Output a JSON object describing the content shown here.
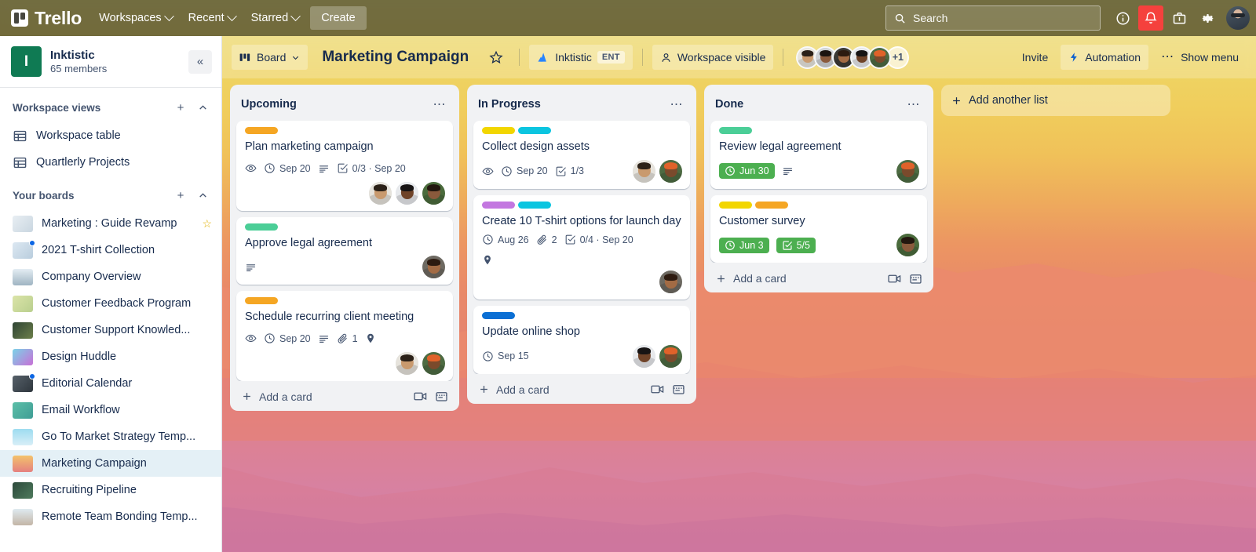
{
  "topnav": {
    "brand": "Trello",
    "menus": [
      {
        "label": "Workspaces",
        "name": "workspaces"
      },
      {
        "label": "Recent",
        "name": "recent"
      },
      {
        "label": "Starred",
        "name": "starred"
      }
    ],
    "create_label": "Create",
    "search_placeholder": "Search",
    "icons": [
      "info-icon",
      "notification-bell-icon",
      "briefcase-icon",
      "gear-icon",
      "user-avatar"
    ],
    "accent_alert": "#f5413d"
  },
  "sidebar": {
    "workspace": {
      "initial": "I",
      "name": "Inktistic",
      "members": "65 members",
      "logo_color": "#0f7a53",
      "collapse_label": "«"
    },
    "sections": [
      {
        "title": "Workspace views",
        "add_label": "+",
        "collapse_label": "⌃",
        "items": [
          {
            "label": "Workspace table",
            "icon": "table-icon"
          },
          {
            "label": "Quartlerly Projects",
            "icon": "table-icon"
          }
        ]
      },
      {
        "title": "Your boards",
        "add_label": "+",
        "collapse_label": "⌃",
        "items": [
          {
            "label": "Marketing : Guide Revamp",
            "starred": true,
            "badge": false,
            "thumb": "linear-gradient(135deg,#e8eef3,#c9d6e0)"
          },
          {
            "label": "2021 T-shirt Collection",
            "starred": false,
            "badge": true,
            "thumb": "linear-gradient(135deg,#dce8f2,#b9cddd)"
          },
          {
            "label": "Company Overview",
            "starred": false,
            "badge": false,
            "thumb": "linear-gradient(180deg,#e4edf3,#9fb4c2)"
          },
          {
            "label": "Customer Feedback Program",
            "starred": false,
            "badge": false,
            "thumb": "linear-gradient(135deg,#dbe4a8,#b9cf8e)"
          },
          {
            "label": "Customer Support Knowled...",
            "starred": false,
            "badge": false,
            "thumb": "linear-gradient(135deg,#2f4434,#6c7f4a)"
          },
          {
            "label": "Design Huddle",
            "starred": false,
            "badge": false,
            "thumb": "linear-gradient(135deg,#7ad3e8,#c86fd6)"
          },
          {
            "label": "Editorial Calendar",
            "starred": false,
            "badge": true,
            "thumb": "linear-gradient(135deg,#566069,#2e363d)"
          },
          {
            "label": "Email Workflow",
            "starred": false,
            "badge": false,
            "thumb": "linear-gradient(135deg,#5cbfa8,#3f9d95)"
          },
          {
            "label": "Go To Market Strategy Temp...",
            "starred": false,
            "badge": false,
            "thumb": "linear-gradient(180deg,#9ddcf0,#d8eef7)"
          },
          {
            "label": "Marketing Campaign",
            "starred": false,
            "badge": false,
            "active": true,
            "thumb": "linear-gradient(180deg,#f3c26b,#e5807f)"
          },
          {
            "label": "Recruiting Pipeline",
            "starred": false,
            "badge": false,
            "thumb": "linear-gradient(135deg,#2d4a3c,#4e7a5c)"
          },
          {
            "label": "Remote Team Bonding Temp...",
            "starred": false,
            "badge": false,
            "thumb": "linear-gradient(180deg,#dfeaf0,#c3b5a6)"
          }
        ]
      }
    ]
  },
  "board_header": {
    "view_label": "Board",
    "title": "Marketing Campaign",
    "star_icon": "star-outline-icon",
    "workspace_name": "Inktistic",
    "workspace_plan": "ENT",
    "visibility_label": "Workspace visible",
    "member_overflow": "+1",
    "invite_label": "Invite",
    "automation_label": "Automation",
    "show_menu_label": "Show menu",
    "members": [
      {
        "name": "member-1",
        "skin": "#c99a6e",
        "hair": "#2b2118",
        "shirt": "#e9e6de"
      },
      {
        "name": "member-2",
        "skin": "#8a5a3c",
        "hair": "#1c1410",
        "shirt": "#cfd3d6"
      },
      {
        "name": "member-3",
        "skin": "#a36b44",
        "hair": "#2d1b10",
        "shirt": "#3c3a35"
      },
      {
        "name": "member-4",
        "skin": "#6f4328",
        "hair": "#171414",
        "shirt": "#e7e9ec"
      },
      {
        "name": "member-5",
        "skin": "#7a4a2c",
        "hair": "#e0622a",
        "shirt": "#4d6b42"
      }
    ]
  },
  "board": {
    "add_list_label": "Add another list",
    "add_card_label": "Add a card",
    "lists": [
      {
        "title": "Upcoming",
        "cards": [
          {
            "title": "Plan marketing campaign",
            "labels": [
              "#f5a623"
            ],
            "badges": [
              {
                "type": "watch",
                "text": ""
              },
              {
                "type": "due",
                "text": "Sep 20"
              },
              {
                "type": "description",
                "text": ""
              },
              {
                "type": "checklist",
                "text": "0/3 · Sep 20"
              }
            ],
            "members": [
              {
                "skin": "#c99a6e",
                "hair": "#2b2118",
                "shirt": "#e6e3dc"
              },
              {
                "skin": "#6f4328",
                "hair": "#171414",
                "shirt": "#e7e9ec"
              },
              {
                "skin": "#8a5a3c",
                "hair": "#23170f",
                "shirt": "#4a6b3c"
              }
            ],
            "members_inline": false
          },
          {
            "title": "Approve legal agreement",
            "labels": [
              "#4bce97"
            ],
            "badges": [
              {
                "type": "description",
                "text": ""
              }
            ],
            "members": [
              {
                "skin": "#a36b44",
                "hair": "#2d1b10",
                "shirt": "#6e6a62"
              }
            ],
            "members_inline": true
          },
          {
            "title": "Schedule recurring client meeting",
            "labels": [
              "#f5a623"
            ],
            "badges": [
              {
                "type": "watch",
                "text": ""
              },
              {
                "type": "due",
                "text": "Sep 20"
              },
              {
                "type": "description",
                "text": ""
              },
              {
                "type": "attachment",
                "text": "1"
              },
              {
                "type": "location",
                "text": ""
              }
            ],
            "members": [
              {
                "skin": "#c99a6e",
                "hair": "#2b2118",
                "shirt": "#e6e3dc"
              },
              {
                "skin": "#7a4a2c",
                "hair": "#e0622a",
                "shirt": "#4d6b42"
              }
            ],
            "members_inline": false
          }
        ]
      },
      {
        "title": "In Progress",
        "cards": [
          {
            "title": "Collect design assets",
            "labels": [
              "#f2d600",
              "#0bc5e0"
            ],
            "badges": [
              {
                "type": "watch",
                "text": ""
              },
              {
                "type": "due",
                "text": "Sep 20"
              },
              {
                "type": "checklist",
                "text": "1/3"
              }
            ],
            "members": [
              {
                "skin": "#c99a6e",
                "hair": "#2b2118",
                "shirt": "#e6e3dc"
              },
              {
                "skin": "#7a4a2c",
                "hair": "#e0622a",
                "shirt": "#4d6b42"
              }
            ],
            "members_inline": true
          },
          {
            "title": "Create 10 T-shirt options for launch day",
            "labels": [
              "#c377e0",
              "#0bc5e0"
            ],
            "badges": [
              {
                "type": "due",
                "text": "Aug 26"
              },
              {
                "type": "attachment",
                "text": "2"
              },
              {
                "type": "checklist",
                "text": "0/4 · Sep 20"
              },
              {
                "type": "location-row",
                "text": ""
              }
            ],
            "members": [
              {
                "skin": "#a36b44",
                "hair": "#2d1b10",
                "shirt": "#6e6a62"
              }
            ],
            "members_inline": false
          },
          {
            "title": "Update online shop",
            "labels": [
              "#0b6fd4"
            ],
            "badges": [
              {
                "type": "due",
                "text": "Sep 15"
              }
            ],
            "members": [
              {
                "skin": "#6f4328",
                "hair": "#171414",
                "shirt": "#e7e9ec"
              },
              {
                "skin": "#7a4a2c",
                "hair": "#e0622a",
                "shirt": "#4d6b42"
              }
            ],
            "members_inline": true
          }
        ]
      },
      {
        "title": "Done",
        "cards": [
          {
            "title": "Review legal agreement",
            "labels": [
              "#4bce97"
            ],
            "badges": [
              {
                "type": "due-done",
                "text": "Jun 30"
              },
              {
                "type": "description",
                "text": ""
              }
            ],
            "members": [
              {
                "skin": "#7a4a2c",
                "hair": "#e0622a",
                "shirt": "#4d6b42"
              }
            ],
            "members_inline": true
          },
          {
            "title": "Customer survey",
            "labels": [
              "#f2d600",
              "#f5a623"
            ],
            "badges": [
              {
                "type": "due-done",
                "text": "Jun 3"
              },
              {
                "type": "checklist-done",
                "text": "5/5"
              }
            ],
            "members": [
              {
                "skin": "#8a5a3c",
                "hair": "#23170f",
                "shirt": "#4a6b3c"
              }
            ],
            "members_inline": true
          }
        ]
      }
    ]
  }
}
